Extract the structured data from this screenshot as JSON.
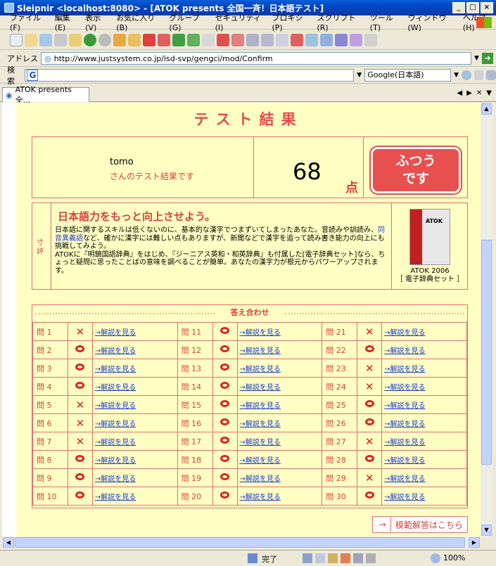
{
  "window": {
    "title": "Sleipnir <localhost:8080> - [ATOK presents 全国一斉！日本語テスト]"
  },
  "menu": [
    "ファイル(F)",
    "編集(E)",
    "表示(V)",
    "お気に入り(B)",
    "グループ(G)",
    "セキュリティ(I)",
    "プロキシ(P)",
    "スクリプト(R)",
    "ツール(T)",
    "ウィンドウ(W)",
    "ヘルプ(H)"
  ],
  "address": {
    "label": "アドレス",
    "url": "http://www.justsystem.co.jp/isd-svp/gengci/mod/Confirm"
  },
  "search": {
    "label": "検索",
    "engine": "Google(日本語)"
  },
  "tab": {
    "label": "ATOK presents 全..."
  },
  "page": {
    "heading": "テスト結果",
    "user_name": "tomo",
    "user_suffix": "さんのテスト結果です",
    "score": "68",
    "score_unit": "点",
    "verdict_line1": "ふつう",
    "verdict_line2": "です",
    "comment_label": "寸評",
    "comment_title": "日本語力をもっと向上させよう。",
    "comment_1": "日本語に関するスキルは低くないのに、基本的な漢字でつまずいてしまったあなた。音読みや訓読み、",
    "comment_link": "同音異義語",
    "comment_2": "など、確かに漢字には難しい点もありますが、新聞などで漢字を追って読み書き能力の向上にも挑戦してみよう。",
    "comment_3": "ATOKに『明鏡国語辞典』をはじめ、『ジーニアス英和・和英辞典』も付属した[電子辞典セット]なら、ちょっと疑問に思ったことばの意味を調べることが簡単。あなたの漢字力が根元からパワーアップされます。",
    "product_box": "ATOK",
    "product_name": "ATOK 2006",
    "product_sub": "［ 電子辞典セット ］",
    "answers_heading": "答え合わせ",
    "link_text": "→解説を見る",
    "model_button": "模範解答はこちら"
  },
  "answers": [
    {
      "q": "問 1",
      "r": "x"
    },
    {
      "q": "問 2",
      "r": "o"
    },
    {
      "q": "問 3",
      "r": "o"
    },
    {
      "q": "問 4",
      "r": "o"
    },
    {
      "q": "問 5",
      "r": "x"
    },
    {
      "q": "問 6",
      "r": "x"
    },
    {
      "q": "問 7",
      "r": "x"
    },
    {
      "q": "問 8",
      "r": "o"
    },
    {
      "q": "問 9",
      "r": "o"
    },
    {
      "q": "問 10",
      "r": "o"
    },
    {
      "q": "問 11",
      "r": "o"
    },
    {
      "q": "問 12",
      "r": "o"
    },
    {
      "q": "問 13",
      "r": "o"
    },
    {
      "q": "問 14",
      "r": "o"
    },
    {
      "q": "問 15",
      "r": "o"
    },
    {
      "q": "問 16",
      "r": "o"
    },
    {
      "q": "問 17",
      "r": "o"
    },
    {
      "q": "問 18",
      "r": "o"
    },
    {
      "q": "問 19",
      "r": "o"
    },
    {
      "q": "問 20",
      "r": "o"
    },
    {
      "q": "問 21",
      "r": "x"
    },
    {
      "q": "問 22",
      "r": "o"
    },
    {
      "q": "問 23",
      "r": "x"
    },
    {
      "q": "問 24",
      "r": "x"
    },
    {
      "q": "問 25",
      "r": "o"
    },
    {
      "q": "問 26",
      "r": "o"
    },
    {
      "q": "問 27",
      "r": "x"
    },
    {
      "q": "問 28",
      "r": "o"
    },
    {
      "q": "問 29",
      "r": "x"
    },
    {
      "q": "問 30",
      "r": "o"
    }
  ],
  "status": {
    "text": "完了",
    "zoom": "100%"
  },
  "colors": {
    "accent": "#e84a4a",
    "page_bg": "#ffffc4",
    "border": "#e07070"
  }
}
